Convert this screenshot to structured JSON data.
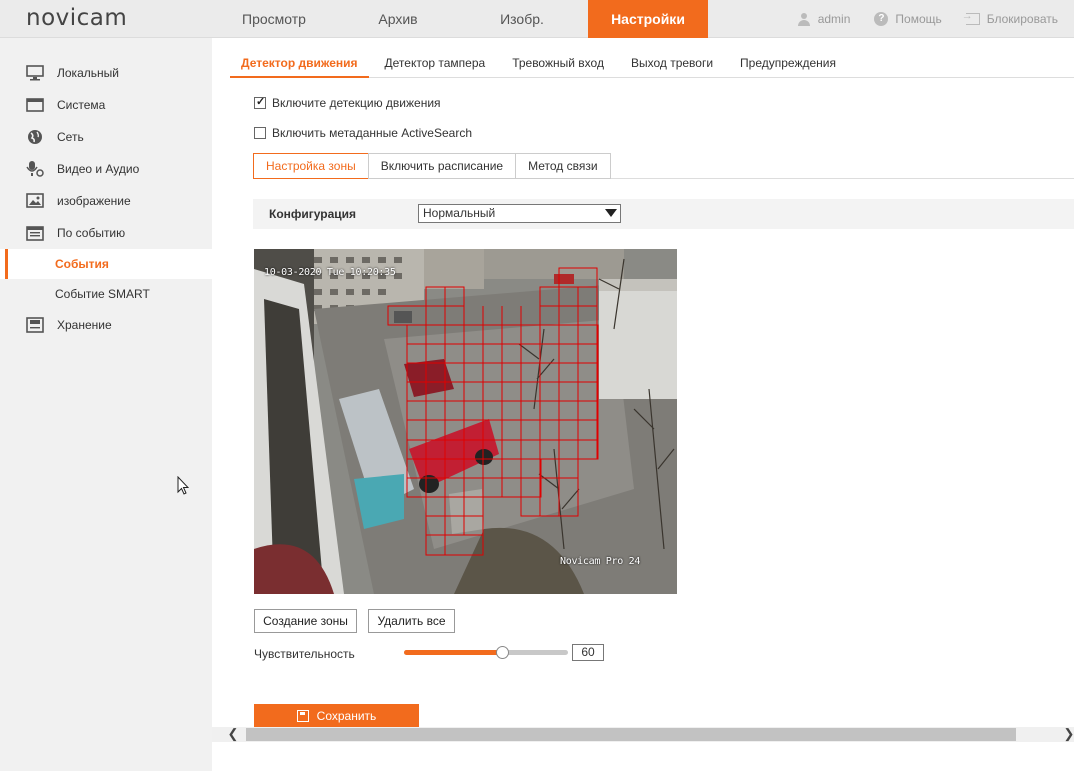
{
  "brand": {
    "logo": "novicam"
  },
  "topnav": [
    {
      "label": "Просмотр"
    },
    {
      "label": "Архив"
    },
    {
      "label": "Изобр."
    },
    {
      "label": "Настройки",
      "active": true
    }
  ],
  "topright": {
    "user": "admin",
    "help": "Помощь",
    "lock": "Блокировать"
  },
  "sidebar": {
    "items": [
      {
        "label": "Локальный",
        "icon": "monitor-icon"
      },
      {
        "label": "Система",
        "icon": "window-icon"
      },
      {
        "label": "Сеть",
        "icon": "globe-icon"
      },
      {
        "label": "Видео и Аудио",
        "icon": "microphone-icon"
      },
      {
        "label": "изображение",
        "icon": "image-icon"
      },
      {
        "label": "По событию",
        "icon": "calendar-icon"
      }
    ],
    "subitems": [
      {
        "label": "События",
        "active": true
      },
      {
        "label": "Событие SMART"
      }
    ],
    "storage": {
      "label": "Хранение",
      "icon": "storage-icon"
    }
  },
  "subtabs": [
    {
      "label": "Детектор движения",
      "active": true
    },
    {
      "label": "Детектор тампера"
    },
    {
      "label": "Тревожный вход"
    },
    {
      "label": "Выход тревоги"
    },
    {
      "label": "Предупреждения"
    }
  ],
  "options": {
    "enable_motion": {
      "label": "Включите детекцию движения",
      "checked": true
    },
    "enable_metadata": {
      "label": "Включить метаданные ActiveSearch",
      "checked": false
    }
  },
  "steps": [
    {
      "label": "Настройка зоны",
      "active": true
    },
    {
      "label": "Включить расписание"
    },
    {
      "label": "Метод связи"
    }
  ],
  "config": {
    "label": "Конфигурация",
    "value": "Нормальный"
  },
  "video": {
    "timestamp": "10-03-2020 Tue 10:20:35",
    "watermark": "Novicam Pro 24"
  },
  "buttons": {
    "create_zone": "Создание зоны",
    "delete_all": "Удалить все",
    "save": "Сохранить"
  },
  "sensitivity": {
    "label": "Чувствительность",
    "value": "60",
    "fraction": 0.6
  },
  "colors": {
    "accent": "#f26b1d",
    "grid": "#e00000"
  }
}
